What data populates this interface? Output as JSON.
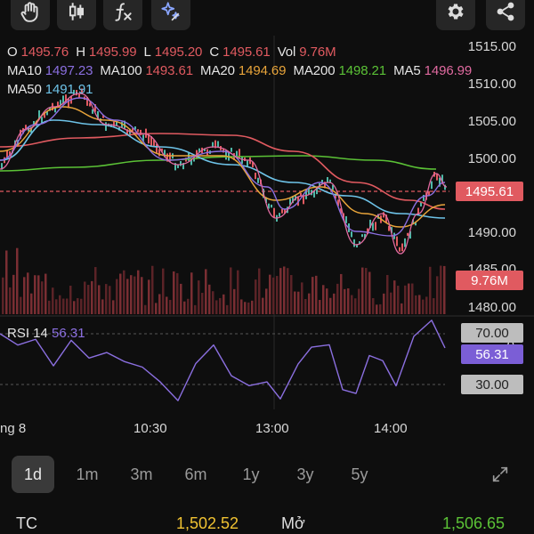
{
  "toolbar": {
    "tools": [
      "hand-icon",
      "candlestick-icon",
      "function-icon",
      "sparkle-icon"
    ],
    "right": [
      "gear-icon",
      "share-icon"
    ]
  },
  "ohlc": {
    "o_label": "O",
    "o": "1495.76",
    "h_label": "H",
    "h": "1495.99",
    "l_label": "L",
    "l": "1495.20",
    "c_label": "C",
    "c": "1495.61",
    "vol_label": "Vol",
    "vol": "9.76M"
  },
  "ma": {
    "ma10_label": "MA10",
    "ma10": "1497.23",
    "ma100_label": "MA100",
    "ma100": "1493.61",
    "ma20_label": "MA20",
    "ma20": "1494.69",
    "ma200_label": "MA200",
    "ma200": "1498.21",
    "ma5_label": "MA5",
    "ma5": "1496.99",
    "ma50_label": "MA50",
    "ma50": "1491.91"
  },
  "colors": {
    "red": "#e05a60",
    "purple": "#8b6fe0",
    "green": "#5bc236",
    "orange": "#e8a43a",
    "pink": "#e06aa0",
    "cyan": "#6ec3e8",
    "yellow": "#f0c232",
    "darkred": "#b2413f"
  },
  "price_axis": [
    "1515.00",
    "1510.00",
    "1505.00",
    "1500.00",
    "1490.00",
    "1485.00",
    "1480.00"
  ],
  "price_tag": "1495.61",
  "vol_tag": "9.76M",
  "rsi": {
    "label": "RSI 14",
    "value": "56.31",
    "upper": "70.00",
    "lower": "30.00",
    "axis_partial": "0"
  },
  "time_axis": [
    "ng 8",
    "10:30",
    "13:00",
    "14:00"
  ],
  "ranges": [
    "1d",
    "1m",
    "3m",
    "6m",
    "1y",
    "3y",
    "5y"
  ],
  "active_range": "1d",
  "bottom": {
    "tc_label": "TC",
    "tc_value": "1,502.52",
    "open_label": "Mở",
    "open_value": "1,506.65"
  }
}
